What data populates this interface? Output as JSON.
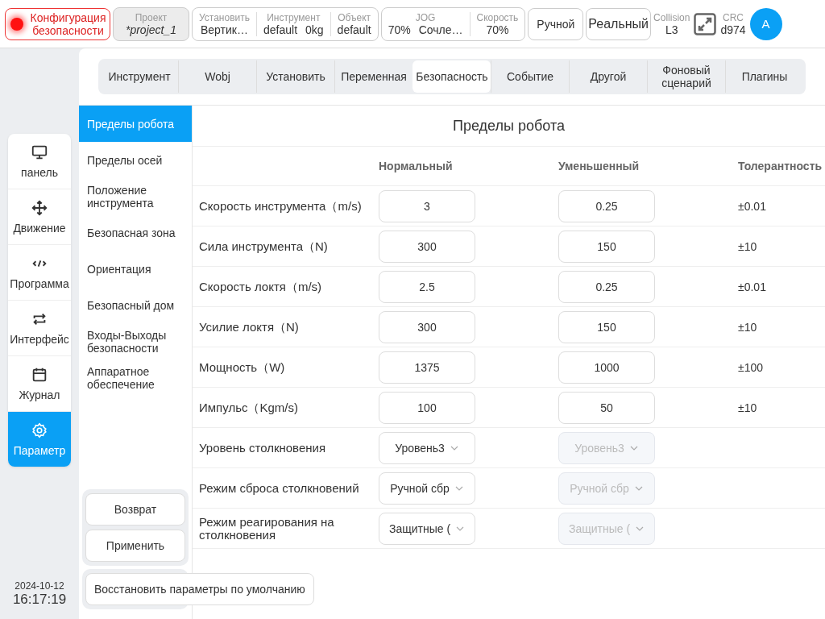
{
  "top_bar": {
    "safety_config": {
      "label": "Конфигурация безопасности",
      "alert": true
    },
    "project": {
      "label": "Проект",
      "value": "*project_1"
    },
    "groups": [
      {
        "fields": [
          {
            "label": "Установить",
            "values": [
              "Вертик…"
            ]
          },
          {
            "label": "Инструмент",
            "values": [
              "default",
              "0kg"
            ]
          },
          {
            "label": "Объект",
            "values": [
              "default"
            ]
          }
        ]
      },
      {
        "fields": [
          {
            "label": "JOG",
            "values": [
              "70%",
              "Сочле…"
            ]
          },
          {
            "label": "Скорость",
            "values": [
              "70%"
            ]
          }
        ]
      }
    ],
    "mode_buttons": [
      "Ручной",
      "Реальный"
    ],
    "collision": {
      "label": "Collision",
      "value": "L3"
    },
    "crc": {
      "label": "CRC",
      "value": "d974"
    },
    "avatar": "A"
  },
  "nav": [
    {
      "label": "панель",
      "selected": false
    },
    {
      "label": "Движение",
      "selected": false
    },
    {
      "label": "Программа",
      "selected": false
    },
    {
      "label": "Интерфейс",
      "selected": false
    },
    {
      "label": "Журнал",
      "selected": false
    },
    {
      "label": "Параметр",
      "selected": true
    }
  ],
  "datetime": {
    "date": "2024-10-12",
    "time": "16:17:19"
  },
  "tabs": [
    {
      "label": "Инструмент",
      "selected": false
    },
    {
      "label": "Wobj",
      "selected": false
    },
    {
      "label": "Установить",
      "selected": false
    },
    {
      "label": "Переменная",
      "selected": false
    },
    {
      "label": "Безопасность",
      "selected": true
    },
    {
      "label": "Событие",
      "selected": false
    },
    {
      "label": "Другой",
      "selected": false
    },
    {
      "label": "Фоновый сценарий",
      "selected": false
    },
    {
      "label": "Плагины",
      "selected": false
    }
  ],
  "sub_nav": [
    {
      "label": "Пределы робота",
      "selected": true
    },
    {
      "label": "Пределы осей",
      "selected": false
    },
    {
      "label": "Положение инструмента",
      "selected": false
    },
    {
      "label": "Безопасная зона",
      "selected": false
    },
    {
      "label": "Ориентация",
      "selected": false
    },
    {
      "label": "Безопасный дом",
      "selected": false
    },
    {
      "label": "Входы-Выходы безопасности",
      "selected": false
    },
    {
      "label": "Аппаратное обеспечение",
      "selected": false
    }
  ],
  "actions": [
    "Возврат",
    "Применить"
  ],
  "restore_button": "Восстановить параметры по умолчанию",
  "panel": {
    "title": "Пределы робота",
    "columns": [
      "Нормальный",
      "Уменьшенный",
      "Толерантность"
    ],
    "rows": [
      {
        "kind": "number",
        "label": "Скорость инструмента（m/s)",
        "normal": {
          "value": "3",
          "disabled": false
        },
        "reduced": {
          "value": "0.25",
          "disabled": false
        },
        "tolerance": "±0.01"
      },
      {
        "kind": "number",
        "label": "Сила инструмента（N)",
        "normal": {
          "value": "300",
          "disabled": false
        },
        "reduced": {
          "value": "150",
          "disabled": false
        },
        "tolerance": "±10"
      },
      {
        "kind": "number",
        "label": "Скорость локтя（m/s)",
        "normal": {
          "value": "2.5",
          "disabled": false
        },
        "reduced": {
          "value": "0.25",
          "disabled": false
        },
        "tolerance": "±0.01"
      },
      {
        "kind": "number",
        "label": "Усилие локтя（N)",
        "normal": {
          "value": "300",
          "disabled": false
        },
        "reduced": {
          "value": "150",
          "disabled": false
        },
        "tolerance": "±10"
      },
      {
        "kind": "number",
        "label": "Мощность（W)",
        "normal": {
          "value": "1375",
          "disabled": false
        },
        "reduced": {
          "value": "1000",
          "disabled": false
        },
        "tolerance": "±100"
      },
      {
        "kind": "number",
        "label": "Импульс（Kgm/s)",
        "normal": {
          "value": "100",
          "disabled": false
        },
        "reduced": {
          "value": "50",
          "disabled": false
        },
        "tolerance": "±10"
      },
      {
        "kind": "select",
        "label": "Уровень столкновения",
        "normal": {
          "value": "Уровень3",
          "disabled": false
        },
        "reduced": {
          "value": "Уровень3",
          "disabled": true
        }
      },
      {
        "kind": "select",
        "label": "Режим сброса столкновений",
        "normal": {
          "value": "Ручной сбр",
          "disabled": false
        },
        "reduced": {
          "value": "Ручной сбр",
          "disabled": true
        }
      },
      {
        "kind": "select",
        "label": "Режим реагирования на столкновения",
        "normal": {
          "value": "Защитные (",
          "disabled": false
        },
        "reduced": {
          "value": "Защитные (",
          "disabled": true
        }
      }
    ]
  }
}
